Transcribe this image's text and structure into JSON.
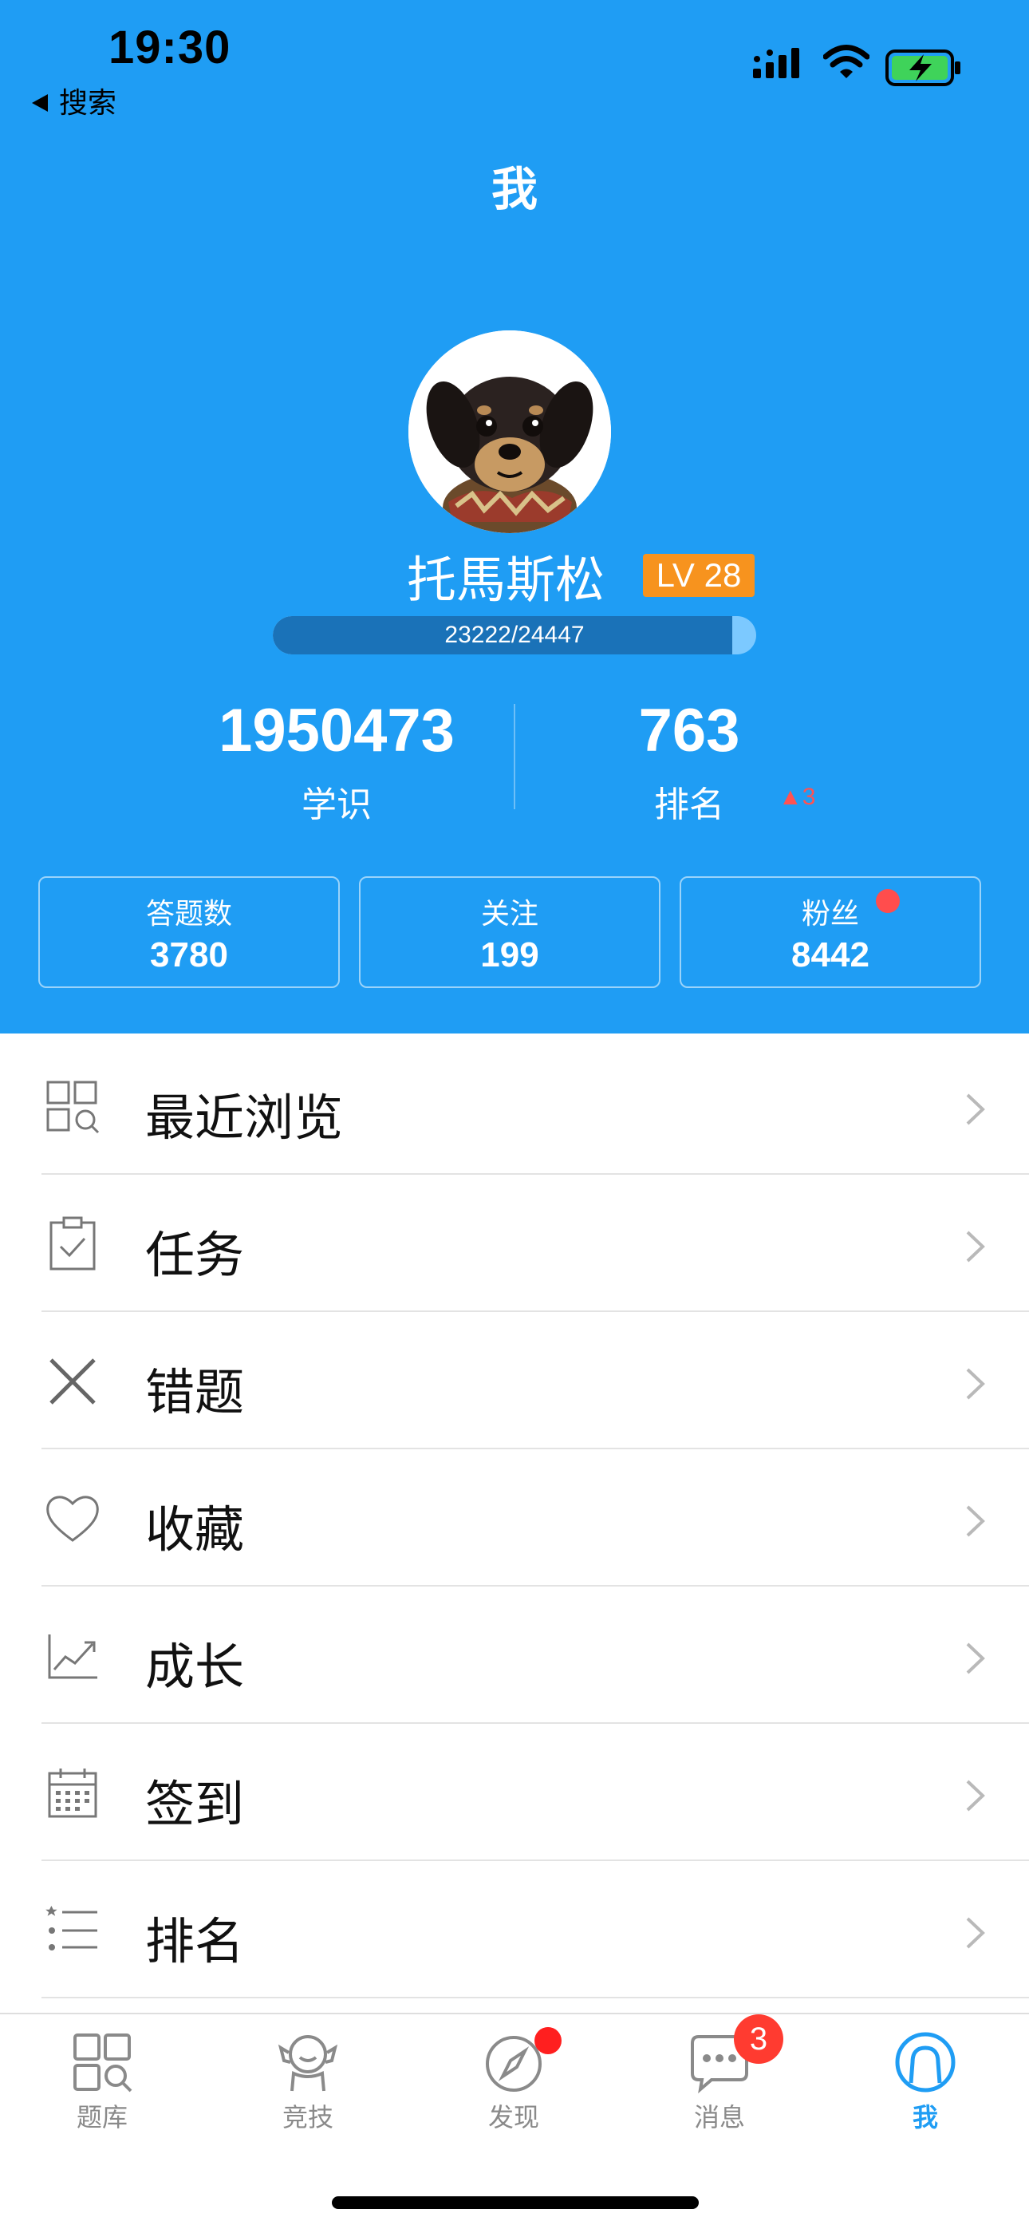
{
  "status_bar": {
    "time": "19:30",
    "back_label": "搜索",
    "icons": [
      "signal-icon",
      "wifi-icon",
      "battery-charging-icon"
    ]
  },
  "nav": {
    "title": "我"
  },
  "profile": {
    "name": "托馬斯松",
    "level": "LV 28",
    "xp_text": "23222/24447",
    "xp_progress": 0.95
  },
  "stats": [
    {
      "value": "1950473",
      "label": "学识"
    },
    {
      "value": "763",
      "label": "排名",
      "change": "▲3"
    }
  ],
  "boxes": [
    {
      "label": "答题数",
      "value": "3780"
    },
    {
      "label": "关注",
      "value": "199"
    },
    {
      "label": "粉丝",
      "value": "8442",
      "has_dot": true
    }
  ],
  "menu": [
    {
      "label": "最近浏览",
      "icon": "recent-browse-icon"
    },
    {
      "label": "任务",
      "icon": "clipboard-check-icon"
    },
    {
      "label": "错题",
      "icon": "cross-icon"
    },
    {
      "label": "收藏",
      "icon": "heart-icon"
    },
    {
      "label": "成长",
      "icon": "growth-chart-icon"
    },
    {
      "label": "签到",
      "icon": "calendar-icon"
    },
    {
      "label": "排名",
      "icon": "ranking-list-icon"
    }
  ],
  "tabs": [
    {
      "label": "题库",
      "icon": "question-bank-icon"
    },
    {
      "label": "竞技",
      "icon": "compete-icon"
    },
    {
      "label": "发现",
      "icon": "compass-icon",
      "dot": true
    },
    {
      "label": "消息",
      "icon": "message-icon",
      "badge": "3"
    },
    {
      "label": "我",
      "icon": "me-icon",
      "active": true
    }
  ],
  "colors": {
    "header_bg": "#1f9df4",
    "level_badge": "#f7931e",
    "accent": "#1f9df4",
    "alert": "#ff3b30"
  }
}
